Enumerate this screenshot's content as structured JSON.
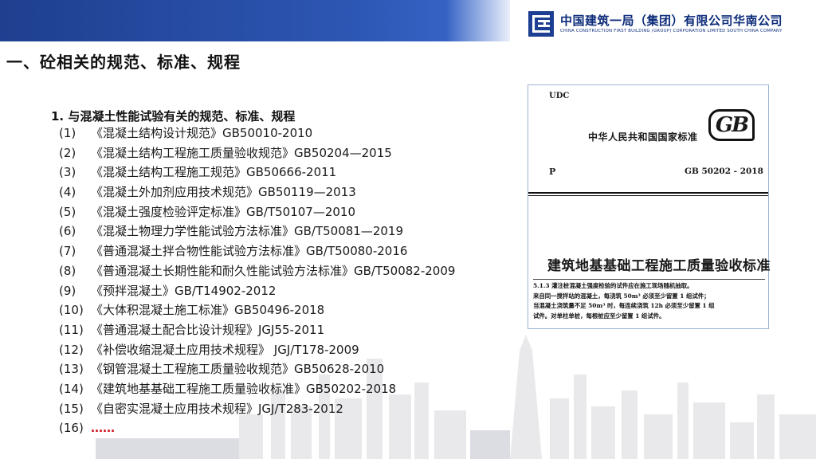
{
  "header": {
    "company_cn": "中国建筑一局（集团）有限公司华南公司",
    "company_en": "CHINA CONSTRUCTION FIRST BUILDING (GROUP) CORPORATION LIMITED SOUTH CHINA COMPANY",
    "logo_glyph": "中建",
    "brand_color": "#1d3f93"
  },
  "section_title": "一、砼相关的规范、标准、规程",
  "subtitle": "1. 与混凝土性能试验有关的规范、标准、规程",
  "items": [
    {
      "num": "(1)",
      "text": "《混凝土结构设计规范》GB50010-2010"
    },
    {
      "num": "(2)",
      "text": "《混凝土结构工程施工质量验收规范》GB50204—2015"
    },
    {
      "num": "(3)",
      "text": "《混凝土结构工程施工规范》GB50666-2011"
    },
    {
      "num": "(4)",
      "text": "《混凝土外加剂应用技术规范》GB50119—2013"
    },
    {
      "num": "(5)",
      "text": "《混凝土强度检验评定标准》GB/T50107—2010"
    },
    {
      "num": "(6)",
      "text": "《混凝土物理力学性能试验方法标准》GB/T50081—2019"
    },
    {
      "num": "(7)",
      "text": "《普通混凝土拌合物性能试验方法标准》GB/T50080-2016"
    },
    {
      "num": "(8)",
      "text": "《普通混凝土长期性能和耐久性能试验方法标准》GB/T50082-2009"
    },
    {
      "num": "(9)",
      "text": "《预拌混凝土》GB/T14902-2012"
    },
    {
      "num": "(10)",
      "text": "《大体积混凝土施工标准》GB50496-2018"
    },
    {
      "num": "(11)",
      "text": "《普通混凝土配合比设计规程》JGJ55-2011"
    },
    {
      "num": "(12)",
      "text": "《补偿收缩混凝土应用技术规程》 JGJ/T178-2009"
    },
    {
      "num": "(13)",
      "text": "《钢管混凝土工程施工质量验收规范》GB50628-2010"
    },
    {
      "num": "(14)",
      "text": "《建筑地基基础工程施工质量验收标准》GB50202-2018"
    },
    {
      "num": "(15)",
      "text": "《自密实混凝土应用技术规程》JGJ/T283-2012"
    }
  ],
  "last_item": {
    "num": "(16)",
    "text": "……"
  },
  "document_image": {
    "udc": "UDC",
    "national_standard": "中华人民共和国国家标准",
    "gb_mark": "GB",
    "p": "P",
    "code": "GB 50202 - 2018",
    "title": "建筑地基基础工程施工质量验收标准",
    "clause_lines": [
      "5.1.3    灌注桩混凝土强度检验的试件应在施工现场随机抽取。",
      "来自同一搅拌站的混凝土，每浇筑 50m³ 必须至少留置 1 组试件；",
      "当混凝土浇筑量不足 50m³ 时，每连续浇筑 12h 必须至少留置 1 组",
      "试件。对单柱单桩，每根桩应至少留置 1 组试件。"
    ]
  }
}
